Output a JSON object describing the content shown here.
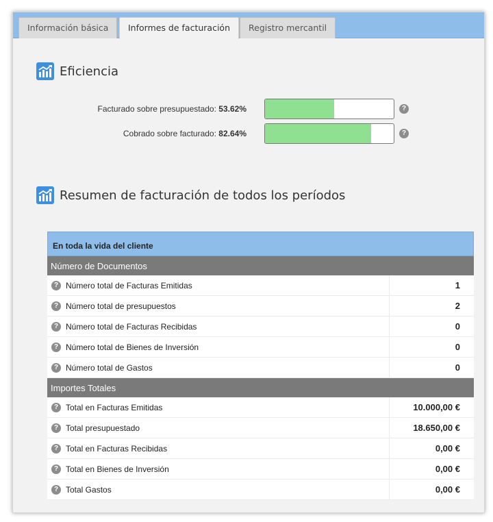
{
  "tabs": [
    {
      "label": "Información básica",
      "active": false
    },
    {
      "label": "Informes de facturación",
      "active": true
    },
    {
      "label": "Registro mercantil",
      "active": false
    }
  ],
  "efficiency": {
    "title": "Eficiencia",
    "rows": [
      {
        "label": "Facturado sobre presupuestado:",
        "value": "53.62%",
        "fraction": 0.5362
      },
      {
        "label": "Cobrado sobre facturado:",
        "value": "82.64%",
        "fraction": 0.8264
      }
    ]
  },
  "summary": {
    "title": "Resumen de facturación de todos los períodos",
    "header": "En toda la vida del cliente",
    "groups": [
      {
        "title": "Número de Documentos",
        "rows": [
          {
            "label": "Número total de Facturas Emitidas",
            "value": "1"
          },
          {
            "label": "Número total de presupuestos",
            "value": "2"
          },
          {
            "label": "Número total de Facturas Recibidas",
            "value": "0"
          },
          {
            "label": "Número total de Bienes de Inversión",
            "value": "0"
          },
          {
            "label": "Número total de Gastos",
            "value": "0"
          }
        ]
      },
      {
        "title": "Importes Totales",
        "rows": [
          {
            "label": "Total en Facturas Emitidas",
            "value": "10.000,00 €"
          },
          {
            "label": "Total presupuestado",
            "value": "18.650,00 €"
          },
          {
            "label": "Total en Facturas Recibidas",
            "value": "0,00 €"
          },
          {
            "label": "Total en Bienes de Inversión",
            "value": "0,00 €"
          },
          {
            "label": "Total Gastos",
            "value": "0,00 €"
          }
        ]
      }
    ]
  },
  "icons": {
    "help": "?"
  },
  "colors": {
    "accent": "#8fbdea",
    "bar_fill": "#90e091",
    "group_header": "#7a7a7a",
    "icon_blue": "#3d8fe0"
  }
}
